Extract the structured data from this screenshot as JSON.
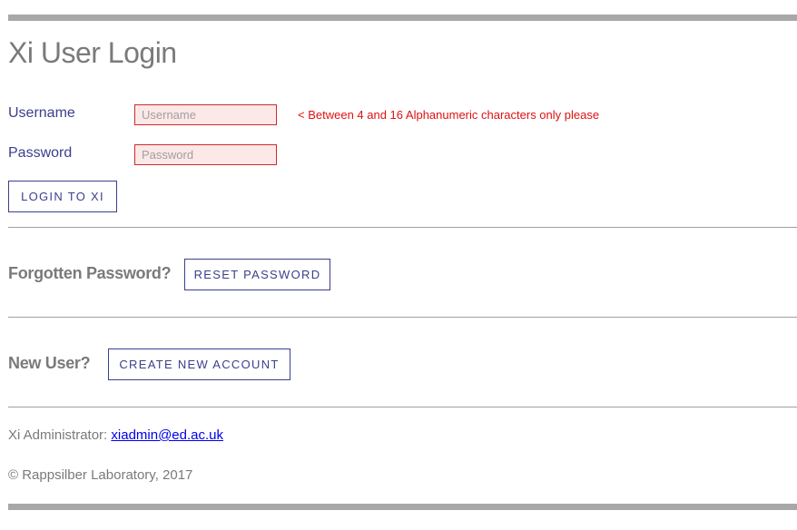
{
  "page": {
    "title": "Xi User Login"
  },
  "login_form": {
    "username_label": "Username",
    "username_placeholder": "Username",
    "username_value": "",
    "username_validation": "< Between 4 and 16 Alphanumeric characters only please",
    "password_label": "Password",
    "password_placeholder": "Password",
    "password_value": "",
    "login_button": "LOGIN TO XI"
  },
  "forgot_section": {
    "heading": "Forgotten Password?",
    "button": "RESET PASSWORD"
  },
  "new_user_section": {
    "heading": "New User?",
    "button": "CREATE NEW ACCOUNT"
  },
  "footer": {
    "admin_label": "Xi Administrator:",
    "admin_email": "xiadmin@ed.ac.uk",
    "copyright": "© Rappsilber Laboratory, 2017"
  },
  "colors": {
    "accent": "#3b3f8c",
    "error": "#e01010",
    "input_error_bg": "#fde8e8",
    "heading_gray": "#7a7a7a",
    "bar_gray": "#a8a8a8"
  }
}
